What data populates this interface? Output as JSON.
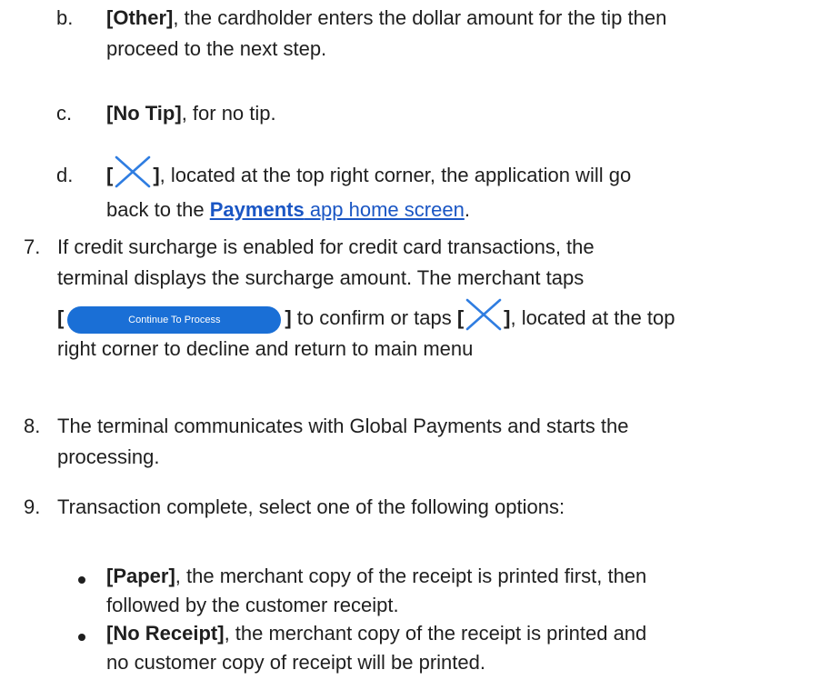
{
  "items": {
    "b": {
      "marker": "b.",
      "bold": "[Other]",
      "text_line1": ", the cardholder enters the dollar amount for the tip then",
      "text_line2": "proceed to the next step."
    },
    "c": {
      "marker": "c.",
      "bold": "[No Tip]",
      "text": ", for no tip."
    },
    "d": {
      "marker": "d.",
      "bracket_open": "[",
      "bracket_close": "]",
      "text_line1": ", located at the top right corner, the application will go",
      "text_line2_prefix": "back to the ",
      "link_bold": "Payments",
      "link_rest": " app home screen",
      "text_line2_suffix": ".",
      "icon": "close-x-icon"
    },
    "step7": {
      "marker": "7.",
      "line1": "If credit surcharge is enabled for credit card transactions, the",
      "line2": "terminal displays the surcharge amount.  The merchant taps",
      "bracket_open": "[",
      "button_label": "Continue To Process",
      "mid_text": "] to confirm or taps ",
      "bracket_open2": "[",
      "bracket_close2": "]",
      "after_icon": ", located at the top",
      "line4": "right corner to decline and return to main menu"
    },
    "step8": {
      "marker": "8.",
      "line1": "The terminal communicates with Global Payments and starts the",
      "line2": "processing."
    },
    "step9": {
      "marker": "9.",
      "line1": "Transaction complete, select one of the following options:"
    },
    "bullet1": {
      "bold": "[Paper]",
      "line1": ", the merchant copy of the receipt is printed first, then",
      "line2": "followed by the customer receipt."
    },
    "bullet2": {
      "bold": "[No Receipt]",
      "line1": ", the merchant copy of the receipt is printed and",
      "line2": "no customer copy of receipt will be printed."
    }
  },
  "colors": {
    "link": "#1a56c4",
    "icon": "#2f7de1",
    "button": "#1a6fd6"
  }
}
